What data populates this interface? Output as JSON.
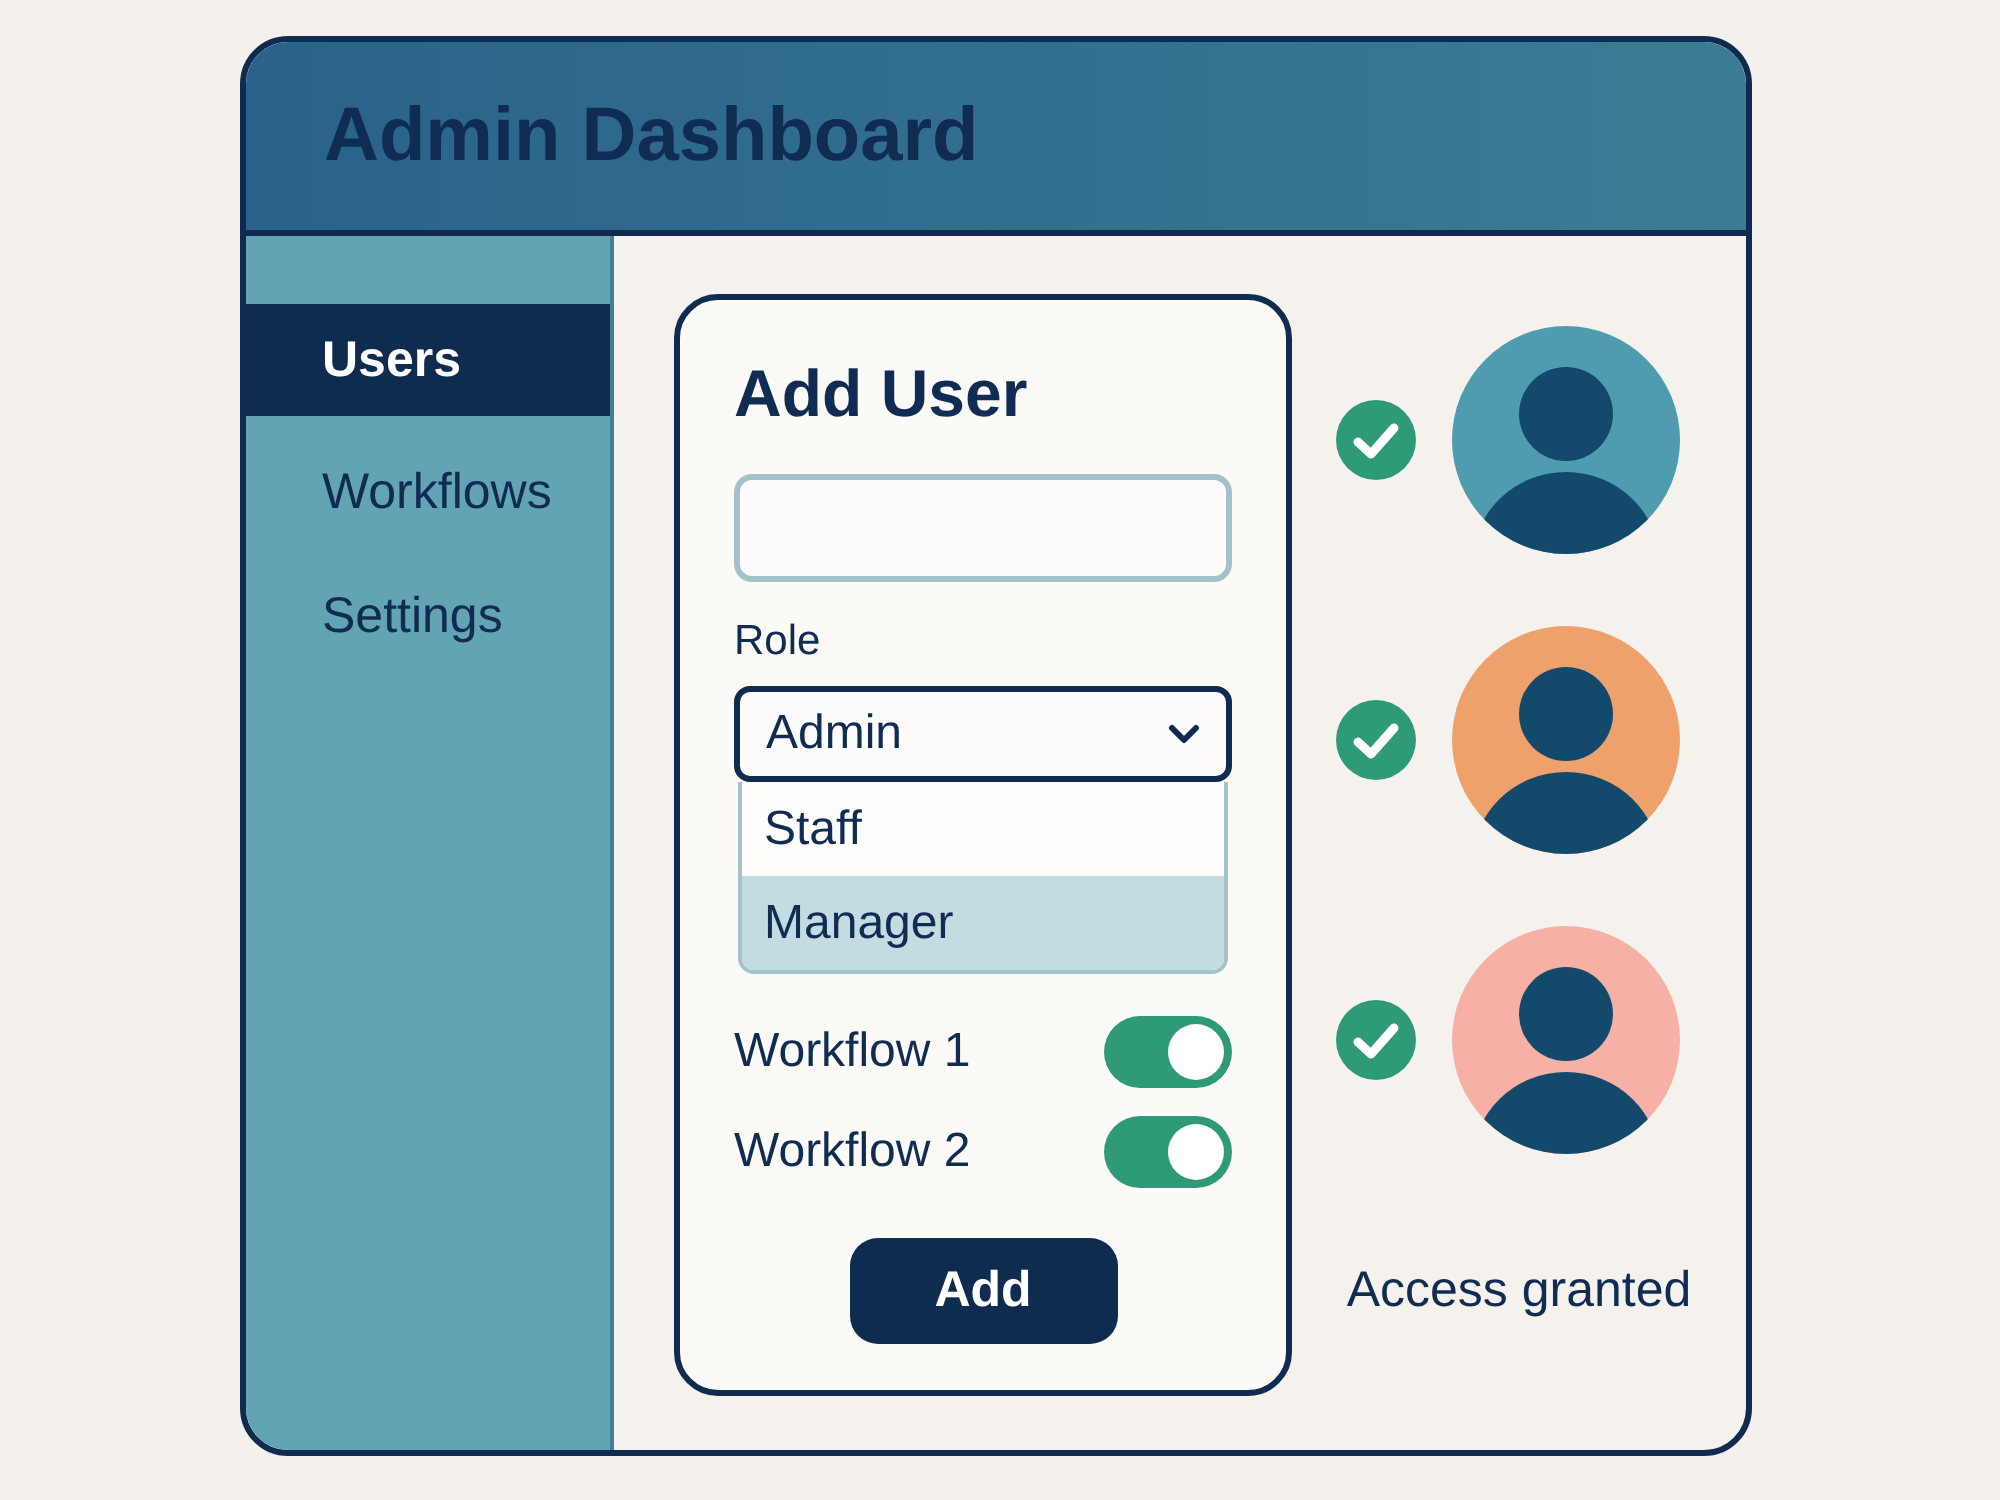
{
  "window": {
    "title": "Admin Dashboard"
  },
  "sidebar": {
    "items": [
      {
        "label": "Users",
        "selected": true
      },
      {
        "label": "Workflows",
        "selected": false
      },
      {
        "label": "Settings",
        "selected": false
      }
    ]
  },
  "form": {
    "title": "Add User",
    "role": {
      "label": "Role",
      "value": "Admin",
      "expanded": true,
      "options": [
        {
          "label": "Staff",
          "selected": false
        },
        {
          "label": "Manager",
          "selected": true
        }
      ]
    },
    "workflows": [
      {
        "label": "Workflow 1",
        "on": true
      },
      {
        "label": "Workflow 2",
        "on": true
      }
    ],
    "submit_button": "Add"
  },
  "users": [
    {
      "color": "#4f9caf",
      "checked": true
    },
    {
      "color": "#eea16b",
      "checked": true
    },
    {
      "color": "#f6b0a5",
      "checked": true
    }
  ],
  "status": "Access granted"
}
